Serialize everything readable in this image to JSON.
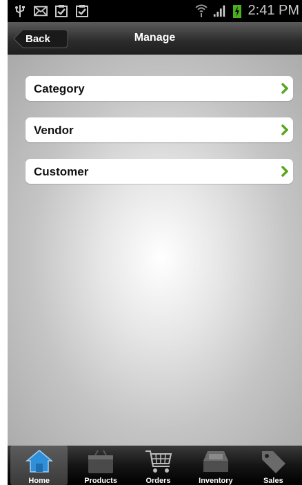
{
  "status_bar": {
    "time": "2:41 PM",
    "left_icons": [
      "usb-icon",
      "mail-icon",
      "clipboard-check-icon",
      "clipboard-check-icon"
    ],
    "right_icons": [
      "wifi-icon",
      "signal-icon",
      "battery-charging-icon"
    ]
  },
  "nav": {
    "back_label": "Back",
    "title": "Manage"
  },
  "menu": {
    "items": [
      {
        "label": "Category"
      },
      {
        "label": "Vendor"
      },
      {
        "label": "Customer"
      }
    ],
    "chevron_color": "#5aa51f"
  },
  "tabs": [
    {
      "label": "Home",
      "icon": "home-icon",
      "active": true
    },
    {
      "label": "Products",
      "icon": "products-box-icon",
      "active": false
    },
    {
      "label": "Orders",
      "icon": "cart-icon",
      "active": false
    },
    {
      "label": "Inventory",
      "icon": "inventory-drawer-icon",
      "active": false
    },
    {
      "label": "Sales",
      "icon": "tag-icon",
      "active": false
    }
  ]
}
